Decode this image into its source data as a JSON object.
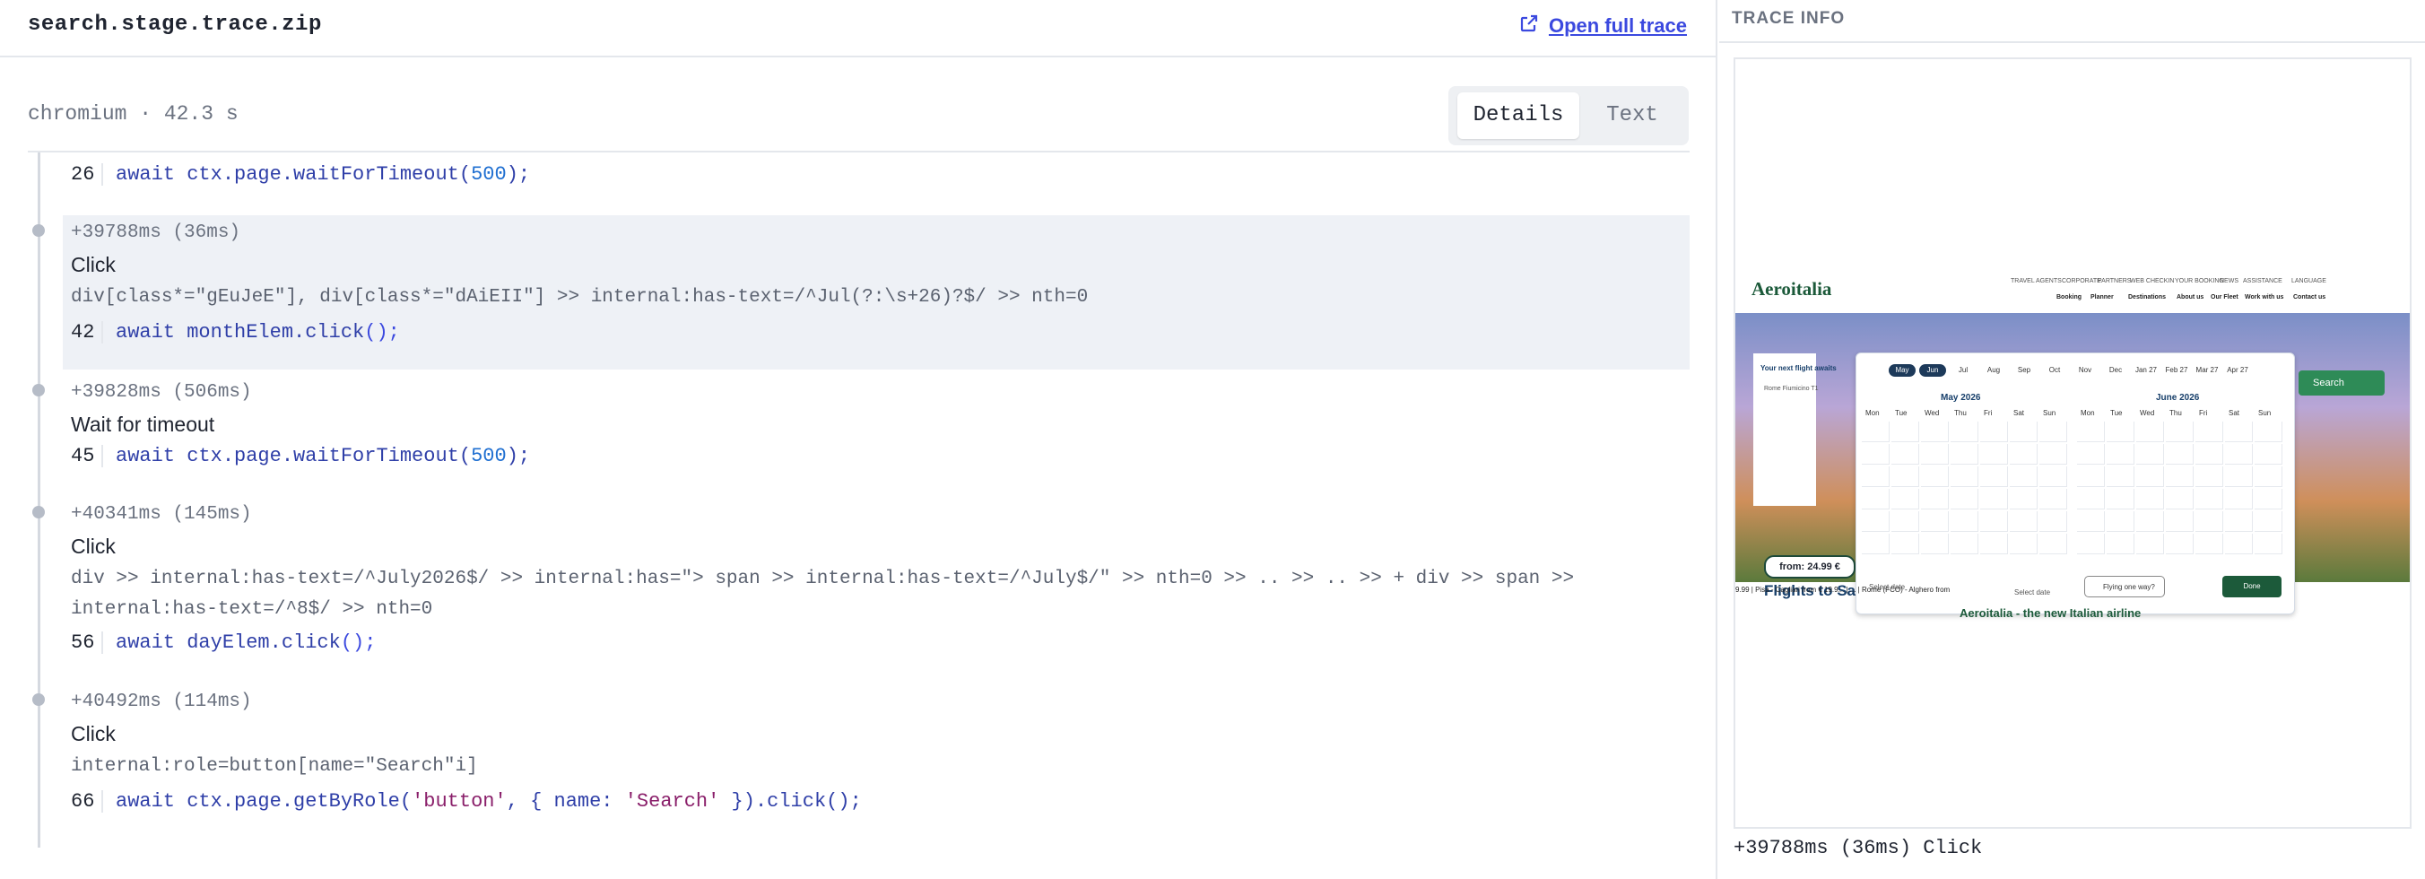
{
  "header": {
    "file_title": "search.stage.trace.zip",
    "open_full_trace": "Open full trace"
  },
  "subheader": {
    "meta": "chromium · 42.3 s",
    "tabs": [
      {
        "label": "Details",
        "active": true
      },
      {
        "label": "Text",
        "active": false
      }
    ]
  },
  "timeline": {
    "top_line": {
      "line": "26",
      "code_prefix": "await ctx.page.waitForTimeout(",
      "code_num": "500",
      "code_suffix": ");"
    },
    "steps": [
      {
        "time": "+39788ms (36ms)",
        "title": "Click",
        "selector": "div[class*=\"gEuJeE\"], div[class*=\"dAiEII\"] >> internal:has-text=/^Jul(?:\\s+26)?$/ >> nth=0",
        "line": "42",
        "code_prefix": "await monthElem.click",
        "code_suffix": "();",
        "highlighted": true
      },
      {
        "time": "+39828ms (506ms)",
        "title": "Wait for timeout",
        "line": "45",
        "code_prefix": "await ctx.page.waitForTimeout(",
        "code_num": "500",
        "code_suffix": ");"
      },
      {
        "time": "+40341ms (145ms)",
        "title": "Click",
        "selector": "div >> internal:has-text=/^July2026$/ >> internal:has=\"> span >> internal:has-text=/^July$/\" >> nth=0 >> .. >> .. >> + div >> span >> internal:has-text=/^8$/ >> nth=0",
        "line": "56",
        "code_prefix": "await dayElem.click",
        "code_suffix": "();"
      },
      {
        "time": "+40492ms (114ms)",
        "title": "Click",
        "selector": "internal:role=button[name=\"Search\"i]",
        "line": "66",
        "code_prefix": "await ctx.page.getByRole(",
        "code_str1": "'button'",
        "code_mid": ", { name: ",
        "code_str2": "'Search'",
        "code_end": " }).click();"
      }
    ]
  },
  "trace_info": {
    "heading": "TRACE INFO",
    "caption": "+39788ms (36ms) Click",
    "screenshot": {
      "logo": "Aeroitalia",
      "top_links": [
        "TRAVEL AGENTS",
        "CORPORATE",
        "PARTNERS",
        "WEB CHECKIN",
        "YOUR BOOKING",
        "NEWS",
        "ASSISTANCE",
        "LANGUAGE"
      ],
      "nav_links": [
        "Booking",
        "Planner",
        "Destinations",
        "About us",
        "Our Fleet",
        "Work with us",
        "Contact us"
      ],
      "months": [
        "May",
        "Jun",
        "Jul",
        "Aug",
        "Sep",
        "Oct",
        "Nov",
        "Dec",
        "Jan 27",
        "Feb 27",
        "Mar 27",
        "Apr 27"
      ],
      "cal_left_title": "May  2026",
      "cal_right_title": "June  2026",
      "weekdays": [
        "Mon",
        "Tue",
        "Wed",
        "Thu",
        "Fri",
        "Sat",
        "Sun"
      ],
      "your_next": "Your next flight awaits",
      "origin": "Rome Fiumicino T1",
      "search": "Search",
      "from_price": "from: 24.99 €",
      "flights_to": "Flights to Sa",
      "fly_one_way": "Flying one way?",
      "done": "Done",
      "select_date_1": "Select date",
      "select_date_2": "Select date",
      "ticker": "9.99  |  Pisa - Cagliari from € 19.9...  |  ...  |  Rome (FCO) - Alghero from",
      "footer": "Aeroitalia - the new Italian airline"
    }
  }
}
